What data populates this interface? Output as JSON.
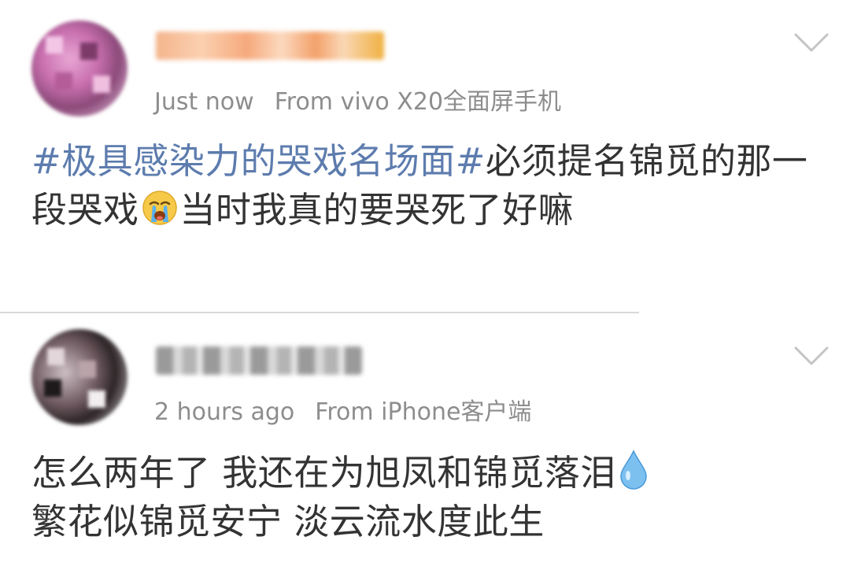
{
  "posts": [
    {
      "time": "Just now",
      "source": "From vivo X20全面屏手机",
      "hashtag": "#极具感染力的哭戏名场面#",
      "text_before_emoji": "必须提名锦觅的那一段哭戏",
      "emoji": "crying-face",
      "text_after_emoji": "当时我真的要哭死了好嘛"
    },
    {
      "time": "2 hours ago",
      "source": "From iPhone客户端",
      "text_before_emoji": "怎么两年了 我还在为旭凤和锦觅落泪",
      "emoji": "droplet",
      "text_after_emoji": "繁花似锦觅安宁 淡云流水度此生"
    }
  ],
  "icons": {
    "expand": "chevron-down-icon"
  },
  "colors": {
    "hashtag": "#5d7cae",
    "meta": "#8d8d8d",
    "text": "#333333"
  }
}
